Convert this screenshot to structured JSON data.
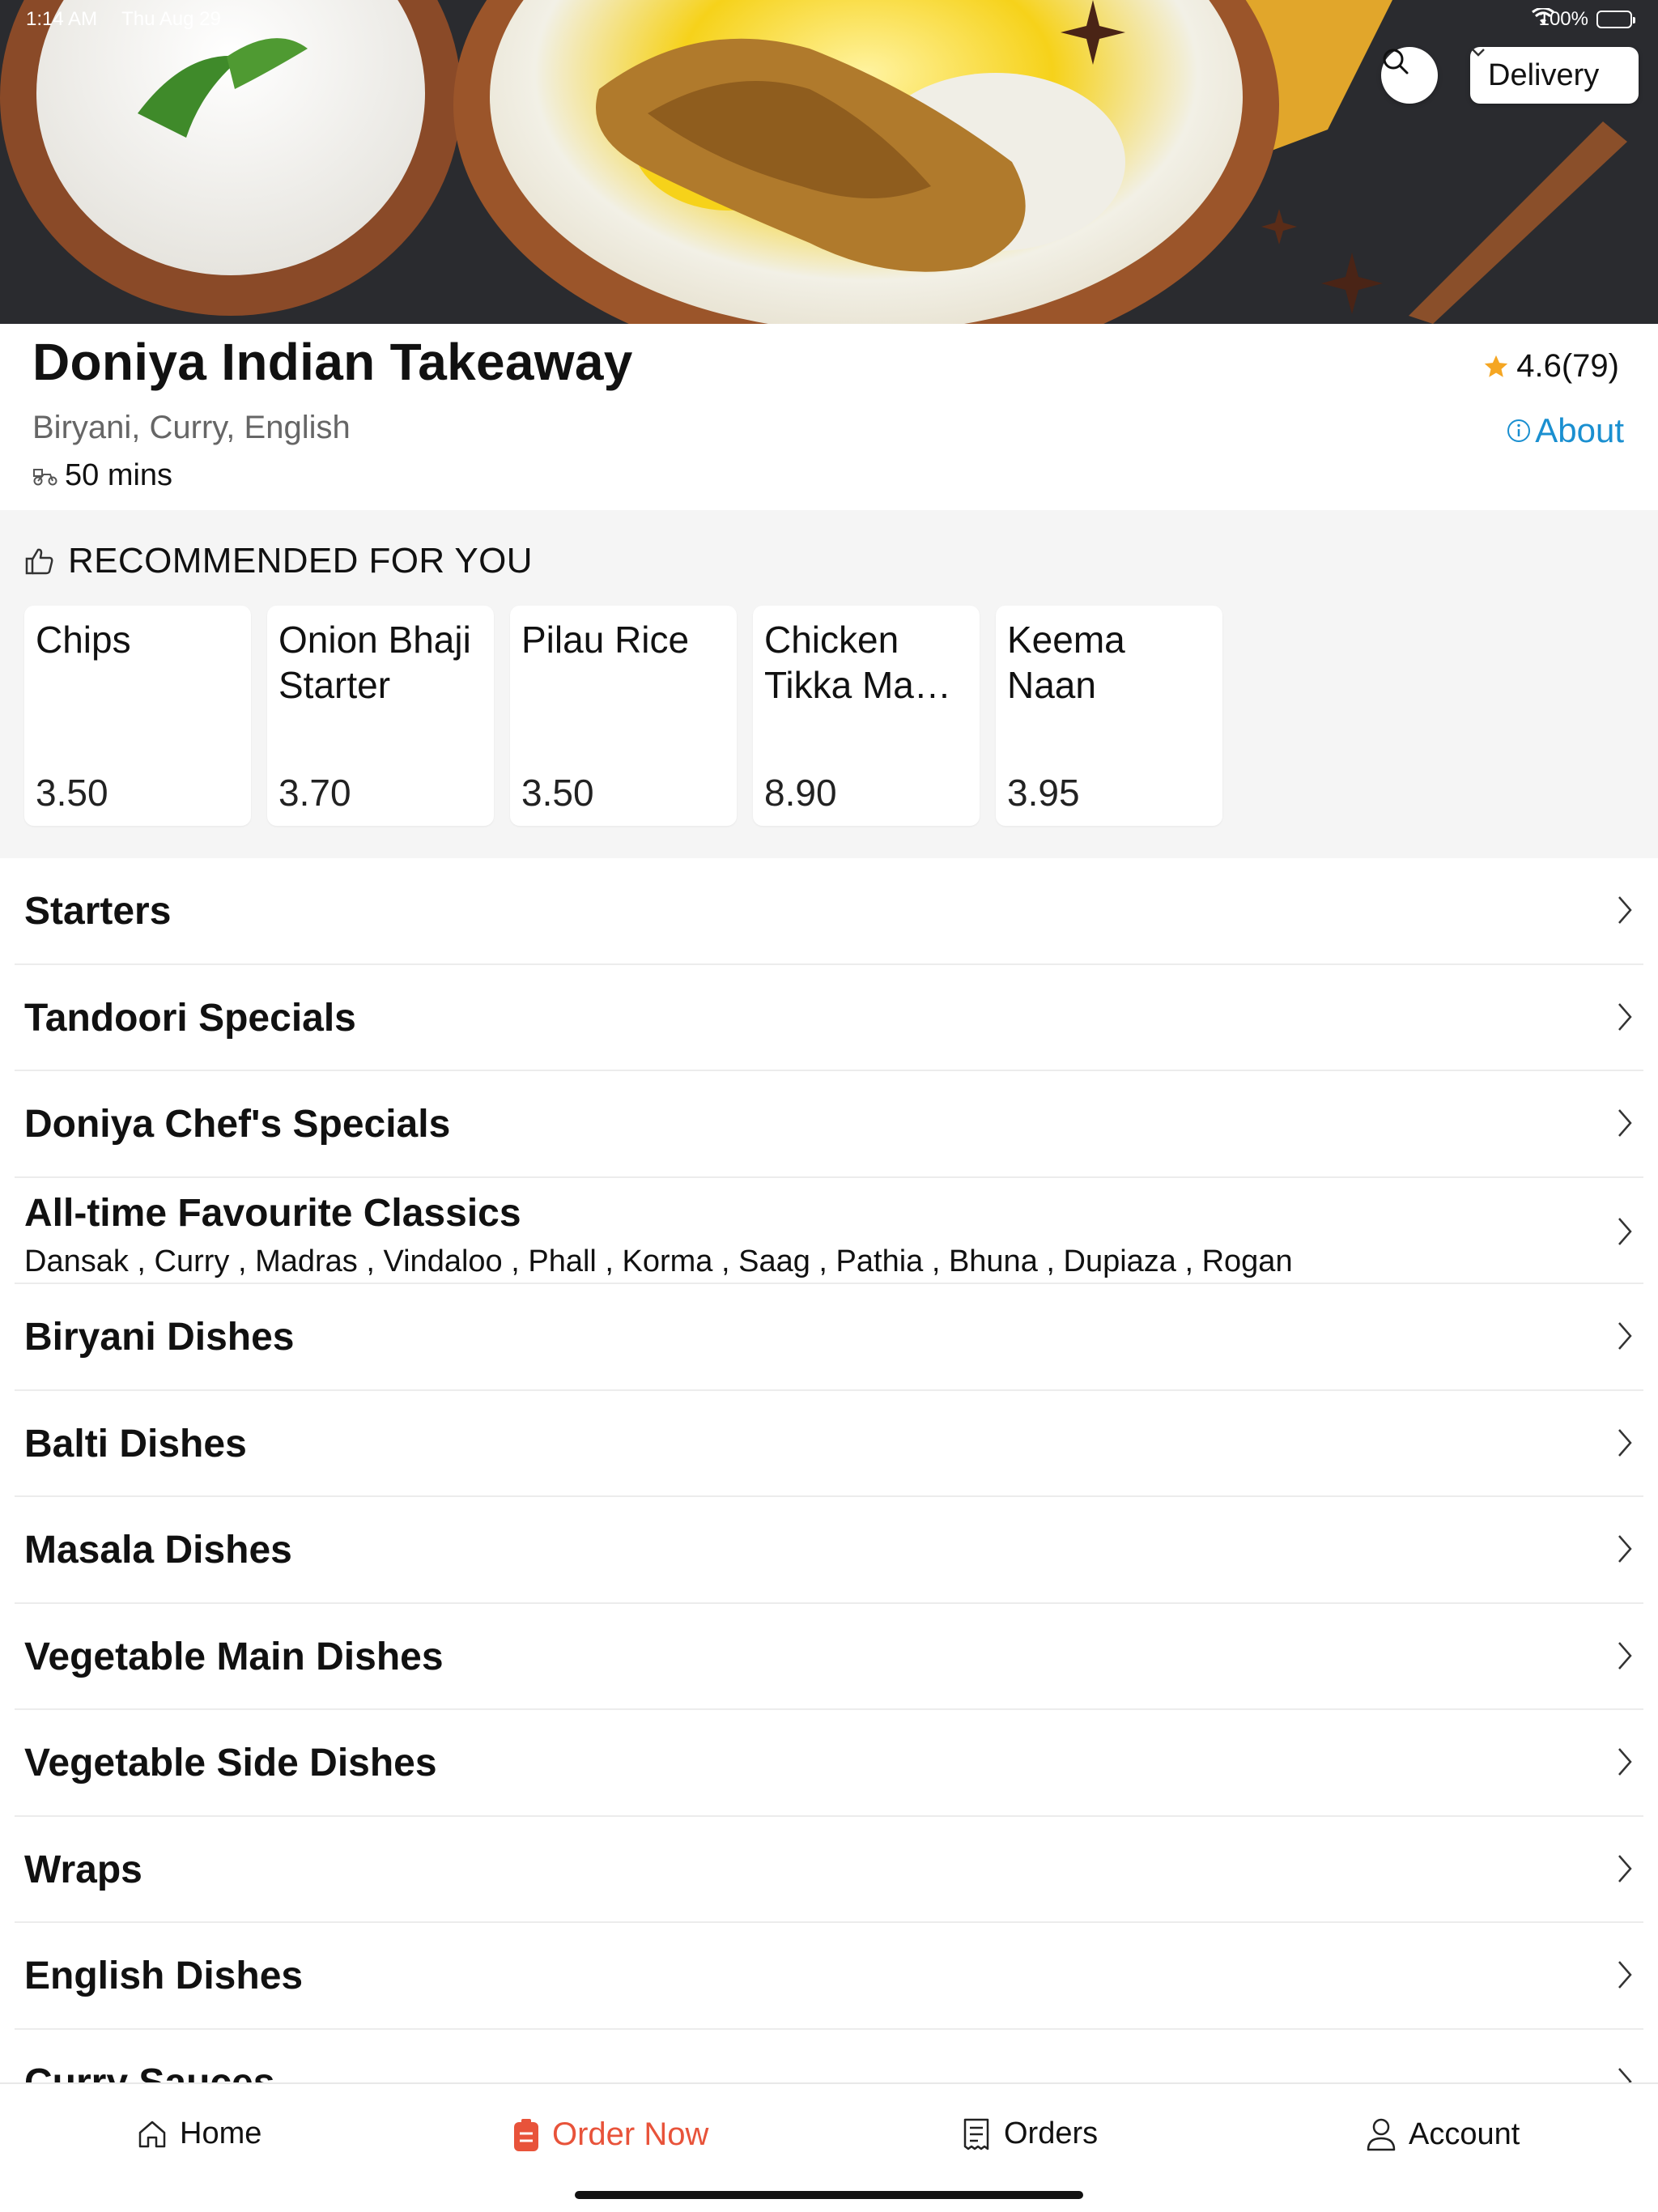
{
  "status_bar": {
    "time": "1:14 AM",
    "date": "Thu Aug 29",
    "battery": "100%",
    "icons": [
      "wifi-icon",
      "battery-icon"
    ]
  },
  "hero": {
    "image": "biryani-hero-photo",
    "search_icon": "search-icon",
    "order_mode": "Delivery"
  },
  "restaurant": {
    "name": "Doniya Indian Takeaway",
    "cuisines": "Biryani, Curry, English",
    "delivery_time": "50 mins",
    "rating": "4.6(79)",
    "about_label": "About"
  },
  "recommended": {
    "title": "RECOMMENDED FOR YOU",
    "items": [
      {
        "name": "Chips",
        "price": "3.50"
      },
      {
        "name": "Onion Bhaji Starter",
        "price": "3.70"
      },
      {
        "name": "Pilau Rice",
        "price": "3.50"
      },
      {
        "name": "Chicken Tikka Ma…",
        "price": "8.90"
      },
      {
        "name": "Keema Naan",
        "price": "3.95"
      }
    ]
  },
  "categories": [
    {
      "title": "Starters"
    },
    {
      "title": "Tandoori Specials"
    },
    {
      "title": "Doniya Chef's Specials"
    },
    {
      "title": "All-time Favourite Classics",
      "subtitle": "Dansak , Curry , Madras , Vindaloo , Phall , Korma , Saag , Pathia , Bhuna , Dupiaza , Rogan"
    },
    {
      "title": "Biryani Dishes"
    },
    {
      "title": "Balti Dishes"
    },
    {
      "title": "Masala Dishes"
    },
    {
      "title": "Vegetable Main Dishes"
    },
    {
      "title": "Vegetable Side Dishes"
    },
    {
      "title": "Wraps"
    },
    {
      "title": "English Dishes"
    },
    {
      "title": "Curry Sauces"
    }
  ],
  "tab_bar": {
    "home": "Home",
    "order_now": "Order Now",
    "orders": "Orders",
    "account": "Account"
  },
  "colors": {
    "accent": "#e8533a",
    "link": "#1a8fd0",
    "star": "#f5a623",
    "section_bg": "#f5f5f5"
  }
}
